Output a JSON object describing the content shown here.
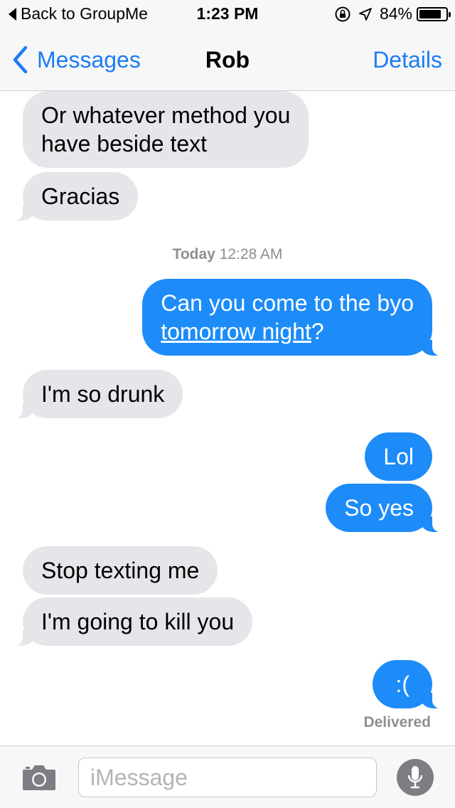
{
  "status_bar": {
    "back_label": "Back to GroupMe",
    "time": "1:23 PM",
    "battery_percent": "84%",
    "battery_level": 0.84,
    "icons": [
      "rotation-lock-icon",
      "location-arrow-icon",
      "battery-icon"
    ]
  },
  "nav": {
    "back_label": "Messages",
    "title": "Rob",
    "details_label": "Details"
  },
  "messages": [
    {
      "direction": "incoming",
      "lines": [
        "Or whatever method you",
        "have beside text"
      ]
    },
    {
      "direction": "incoming",
      "lines": [
        "Gracias"
      ]
    },
    {
      "direction": "outgoing",
      "lines": [
        "Can you come to the byo"
      ],
      "link": "tomorrow night",
      "link_suffix": "?"
    },
    {
      "direction": "incoming",
      "lines": [
        "I'm so drunk"
      ]
    },
    {
      "direction": "outgoing",
      "lines": [
        "Lol"
      ]
    },
    {
      "direction": "outgoing",
      "lines": [
        "So yes"
      ]
    },
    {
      "direction": "incoming",
      "lines": [
        "Stop texting me"
      ]
    },
    {
      "direction": "incoming",
      "lines": [
        "I'm going to kill you"
      ]
    },
    {
      "direction": "outgoing",
      "lines": [
        ":("
      ]
    }
  ],
  "timestamp": {
    "day": "Today",
    "time": "12:28 AM"
  },
  "delivered_label": "Delivered",
  "input": {
    "placeholder": "iMessage"
  },
  "colors": {
    "accent": "#1c7cf4",
    "outgoing_bubble": "#1d8cf8",
    "incoming_bubble": "#e5e5ea",
    "meta_text": "#8e8e93"
  }
}
